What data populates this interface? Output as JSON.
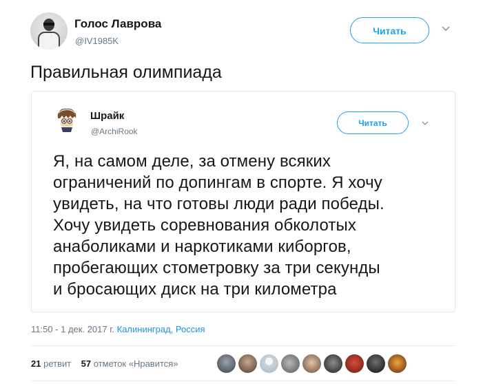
{
  "tweet": {
    "author_name": "Голос Лаврова",
    "author_handle": "@IV1985K",
    "follow_label": "Читать",
    "text": "Правильная олимпиада",
    "timestamp": "11:50 - 1 дек. 2017 г.",
    "location": "Калининград, Россия",
    "retweets_count": "21",
    "retweets_label": "ретвит",
    "likes_count": "57",
    "likes_label": "отметок «Нравится»"
  },
  "quoted": {
    "author_name": "Шрайк",
    "author_handle": "@ArchiRook",
    "follow_label": "Читать",
    "text": "Я, на самом деле, за отмену всяких\nограничений по допингам в спорте. Я хочу\nувидеть, на что готовы люди ради победы.\nХочу увидеть соревнования обколотых\nанаболиками и наркотиками киборгов,\nпробегающих стометровку за три секунды\nи бросающих диск на три километра"
  },
  "colors": {
    "accent": "#1da1f2",
    "secondary_text": "#657786",
    "border": "#e1e8ed"
  },
  "icons": [
    "chevron-down-icon"
  ]
}
